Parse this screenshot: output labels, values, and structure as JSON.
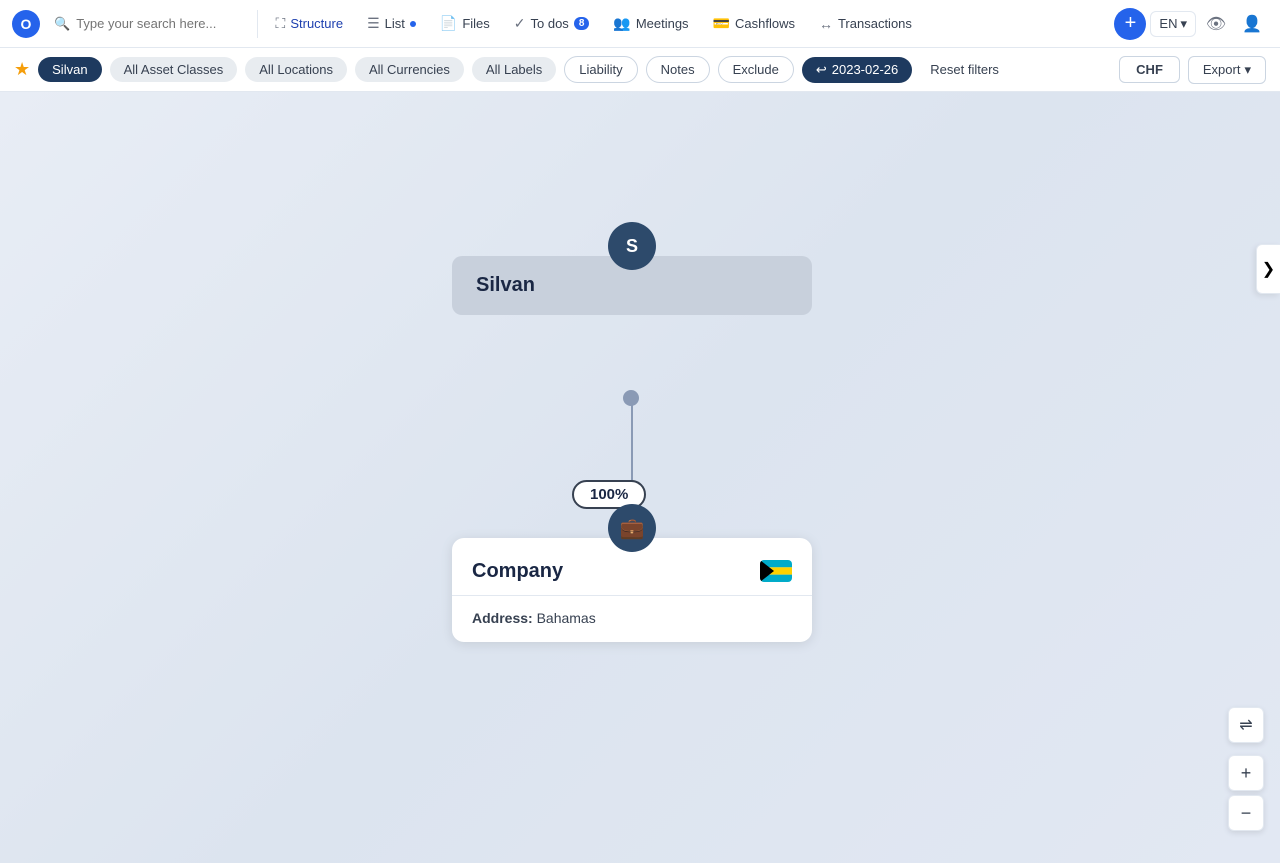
{
  "app": {
    "logo_letter": "O",
    "search_placeholder": "Type your search here..."
  },
  "nav": {
    "items": [
      {
        "id": "structure",
        "label": "Structure",
        "icon": "⛶",
        "active": true
      },
      {
        "id": "list",
        "label": "List",
        "icon": "☰",
        "dot": true
      },
      {
        "id": "files",
        "label": "Files",
        "icon": "📄"
      },
      {
        "id": "todos",
        "label": "To dos",
        "icon": "✓",
        "badge": "8"
      },
      {
        "id": "meetings",
        "label": "Meetings",
        "icon": "👥"
      },
      {
        "id": "cashflows",
        "label": "Cashflows",
        "icon": "💳"
      },
      {
        "id": "transactions",
        "label": "Transactions",
        "icon": "↔"
      }
    ],
    "lang": "EN",
    "add_label": "+",
    "eye_icon": "👁",
    "user_icon": "👤"
  },
  "filters": {
    "star": "★",
    "chips": [
      {
        "id": "silvan",
        "label": "Silvan",
        "style": "dark"
      },
      {
        "id": "asset-classes",
        "label": "All Asset Classes",
        "style": "light"
      },
      {
        "id": "locations",
        "label": "All Locations",
        "style": "light"
      },
      {
        "id": "currencies",
        "label": "All Currencies",
        "style": "light"
      },
      {
        "id": "labels",
        "label": "All Labels",
        "style": "light"
      },
      {
        "id": "liability",
        "label": "Liability",
        "style": "outline"
      },
      {
        "id": "notes",
        "label": "Notes",
        "style": "outline"
      },
      {
        "id": "exclude",
        "label": "Exclude",
        "style": "outline"
      },
      {
        "id": "date",
        "label": "2023-02-26",
        "style": "date",
        "icon": "↩"
      }
    ],
    "reset": "Reset filters",
    "currency": "CHF",
    "export": "Export",
    "export_icon": "▾"
  },
  "canvas": {
    "silvan_node": {
      "avatar_letter": "S",
      "name": "Silvan"
    },
    "percent_label": "100%",
    "company_node": {
      "icon": "💼",
      "name": "Company",
      "address_label": "Address:",
      "address_value": "Bahamas"
    }
  },
  "zoom": {
    "filter_icon": "⇌",
    "plus": "+",
    "minus": "−"
  },
  "collapse": {
    "icon": "❯"
  }
}
